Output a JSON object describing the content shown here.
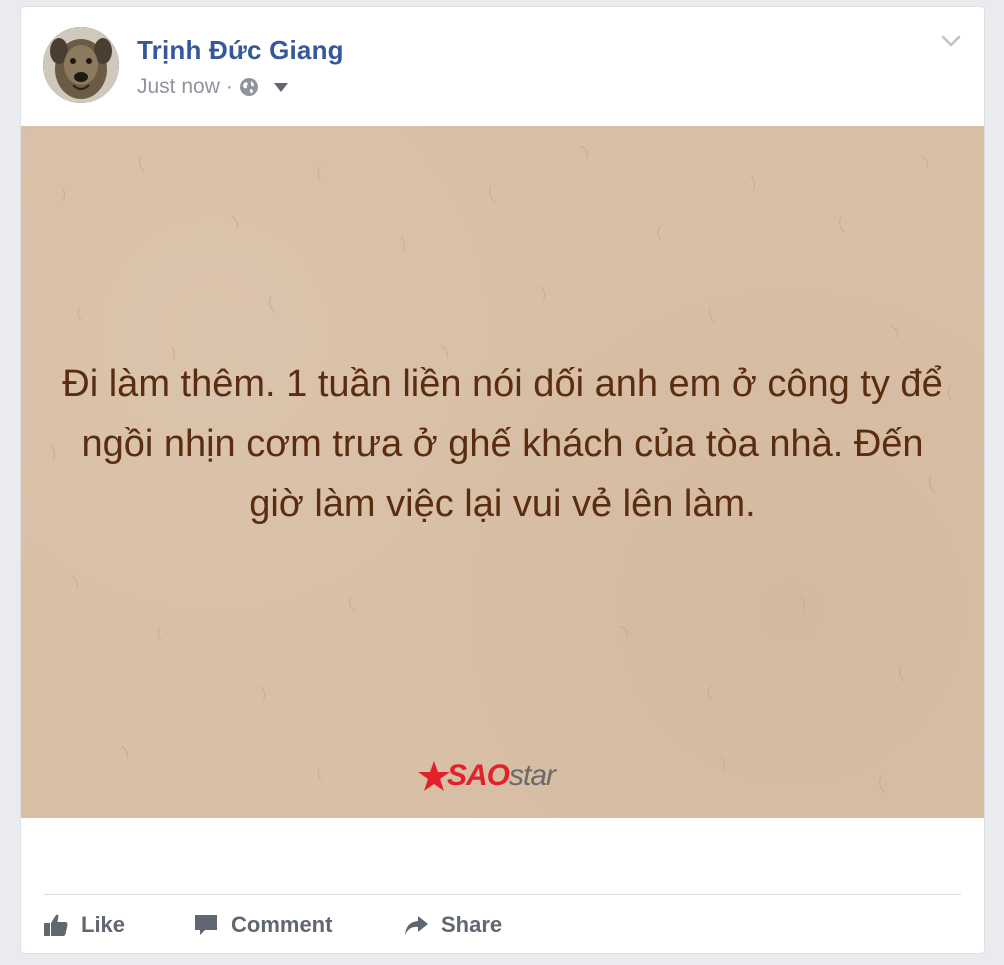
{
  "post": {
    "author": "Trịnh Đức Giang",
    "time": "Just now",
    "separator": "·",
    "privacy_icon": "globe-icon",
    "background_color": "#d8bfa6",
    "text_color": "#5a2d10",
    "text": "Đi làm thêm. 1 tuần liền nói dối anh em ở công ty để ngồi nhịn cơm trưa ở ghế khách của tòa nhà. Đến giờ làm việc lại vui vẻ lên làm.",
    "watermark": {
      "part1": "SAO",
      "part2": "star"
    }
  },
  "actions": {
    "like": "Like",
    "comment": "Comment",
    "share": "Share"
  },
  "colors": {
    "author": "#365899",
    "meta": "#90949c",
    "action": "#606770"
  }
}
